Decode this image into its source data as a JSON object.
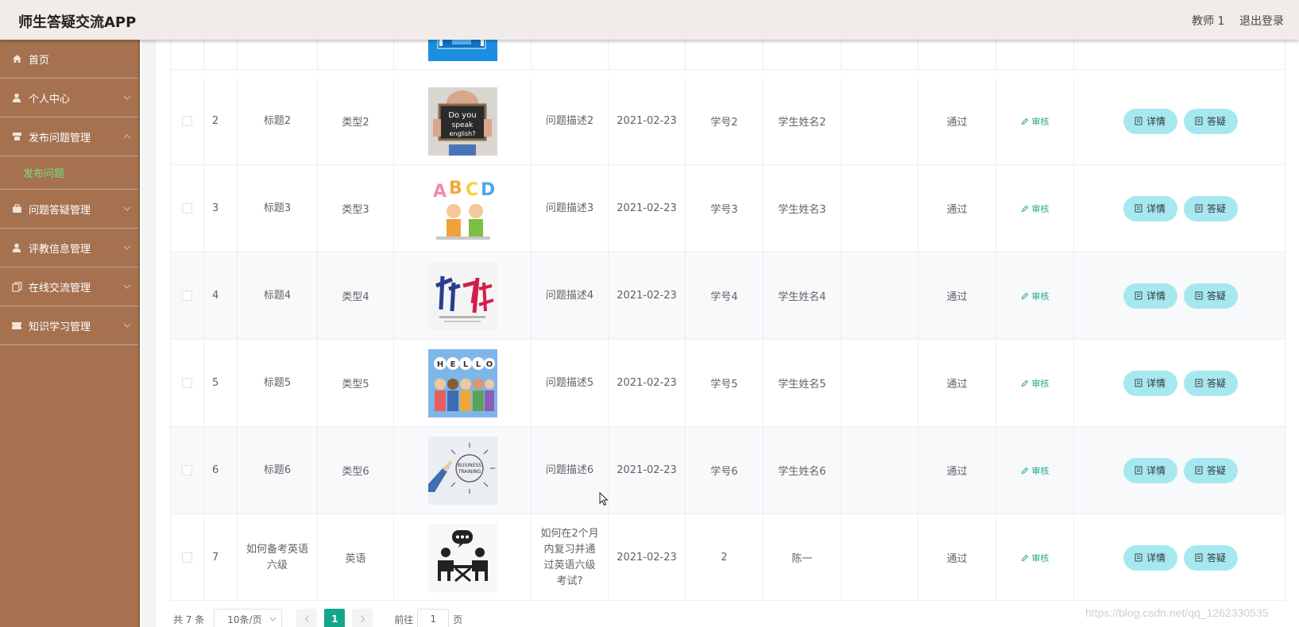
{
  "header": {
    "title": "师生答疑交流APP",
    "user": "教师 1",
    "logout": "退出登录"
  },
  "sidebar": {
    "items": [
      {
        "label": "首页",
        "icon": "home-icon",
        "arrow": false
      },
      {
        "label": "个人中心",
        "icon": "user-icon",
        "arrow": true
      },
      {
        "label": "发布问题管理",
        "icon": "book-icon",
        "arrow": true,
        "expanded": true,
        "children": [
          {
            "label": "发布问题",
            "active": true
          }
        ]
      },
      {
        "label": "问题答疑管理",
        "icon": "briefcase-icon",
        "arrow": true
      },
      {
        "label": "评教信息管理",
        "icon": "user-icon",
        "arrow": true
      },
      {
        "label": "在线交流管理",
        "icon": "copy-icon",
        "arrow": true
      },
      {
        "label": "知识学习管理",
        "icon": "ticket-icon",
        "arrow": true
      }
    ]
  },
  "table": {
    "rows": [
      {
        "id": "",
        "title": "",
        "type": "",
        "image": "blue-sign-image",
        "desc": "",
        "date": "",
        "student_no": "",
        "student_name": "",
        "reply": "",
        "status": "",
        "audit": "",
        "detail": "",
        "answer": ""
      },
      {
        "id": "2",
        "title": "标题2",
        "type": "类型2",
        "image": "do-you-speak-english-image",
        "desc": "问题描述2",
        "date": "2021-02-23",
        "student_no": "学号2",
        "student_name": "学生姓名2",
        "reply": "",
        "status": "通过",
        "audit": "审核",
        "detail": "详情",
        "answer": "答疑"
      },
      {
        "id": "3",
        "title": "标题3",
        "type": "类型3",
        "image": "abcd-kids-image",
        "desc": "问题描述3",
        "date": "2021-02-23",
        "student_no": "学号3",
        "student_name": "学生姓名3",
        "reply": "",
        "status": "通过",
        "audit": "审核",
        "detail": "详情",
        "answer": "答疑"
      },
      {
        "id": "4",
        "title": "标题4",
        "type": "类型4",
        "image": "calligraphy-image",
        "desc": "问题描述4",
        "date": "2021-02-23",
        "student_no": "学号4",
        "student_name": "学生姓名4",
        "reply": "",
        "status": "通过",
        "audit": "审核",
        "detail": "详情",
        "answer": "答疑"
      },
      {
        "id": "5",
        "title": "标题5",
        "type": "类型5",
        "image": "hello-people-image",
        "desc": "问题描述5",
        "date": "2021-02-23",
        "student_no": "学号5",
        "student_name": "学生姓名5",
        "reply": "",
        "status": "通过",
        "audit": "审核",
        "detail": "详情",
        "answer": "答疑"
      },
      {
        "id": "6",
        "title": "标题6",
        "type": "类型6",
        "image": "business-training-image",
        "desc": "问题描述6",
        "date": "2021-02-23",
        "student_no": "学号6",
        "student_name": "学生姓名6",
        "reply": "",
        "status": "通过",
        "audit": "审核",
        "detail": "详情",
        "answer": "答疑"
      },
      {
        "id": "7",
        "title": "如何备考英语六级",
        "type": "英语",
        "image": "conversation-image",
        "desc": "如何在2个月内复习并通过英语六级考试?",
        "date": "2021-02-23",
        "student_no": "2",
        "student_name": "陈一",
        "reply": "",
        "status": "通过",
        "audit": "审核",
        "detail": "详情",
        "answer": "答疑"
      }
    ]
  },
  "pagination": {
    "total": "共 7 条",
    "page_size": "10条/页",
    "current_page": "1",
    "goto_prefix": "前往",
    "goto_value": "1",
    "goto_suffix": "页"
  },
  "watermark": "https://blog.csdn.net/qq_1262330535",
  "colors": {
    "sidebar": "#a5714f",
    "header": "#f1ece9",
    "active_submenu": "#7cde7c",
    "button": "#a6e8f0",
    "accent": "#13a68a"
  }
}
